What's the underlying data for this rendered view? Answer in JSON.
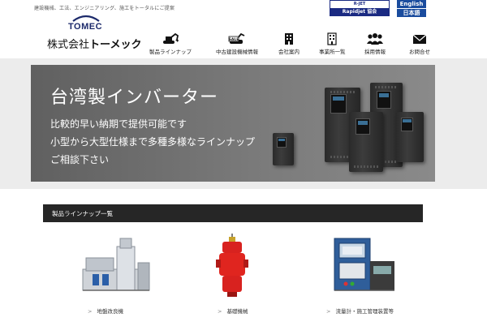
{
  "header": {
    "tagline": "建設機械、工法、エンジニアリング、施工をトータルにご提案",
    "logo_en": "TOMEC",
    "logo_ja_prefix": "株式会社",
    "logo_ja_name": "トーメック",
    "rapidjet_top": "R-JET",
    "rapidjet_bottom": "Rapidjet 協会",
    "lang_en": "English",
    "lang_ja": "日本語"
  },
  "nav": {
    "items": [
      {
        "label": "製品ラインナップ",
        "icon": "excavator-icon"
      },
      {
        "label": "中古建設機械情報",
        "icon": "used-machine-sale-icon"
      },
      {
        "label": "会社案内",
        "icon": "building-icon"
      },
      {
        "label": "事業所一覧",
        "icon": "office-building-icon"
      },
      {
        "label": "採用情報",
        "icon": "people-icon"
      },
      {
        "label": "お問合せ",
        "icon": "envelope-icon"
      }
    ]
  },
  "hero": {
    "title": "台湾製インバーター",
    "line1": "比較的早い納期で提供可能です",
    "line2": "小型から大型仕様まで多種多様なラインナップ",
    "line3": "ご相談下さい"
  },
  "products": {
    "section_title": "製品ラインナップ一覧",
    "items": [
      {
        "label": "地盤改良機"
      },
      {
        "label": "基礎機械"
      },
      {
        "label": "流量計・施工管理装置等"
      }
    ]
  },
  "colors": {
    "brand_navy": "#1c2a6b",
    "lang_blue": "#1a4c9e",
    "section_bar": "#262626",
    "hero_gray": "#6e6e6e"
  }
}
